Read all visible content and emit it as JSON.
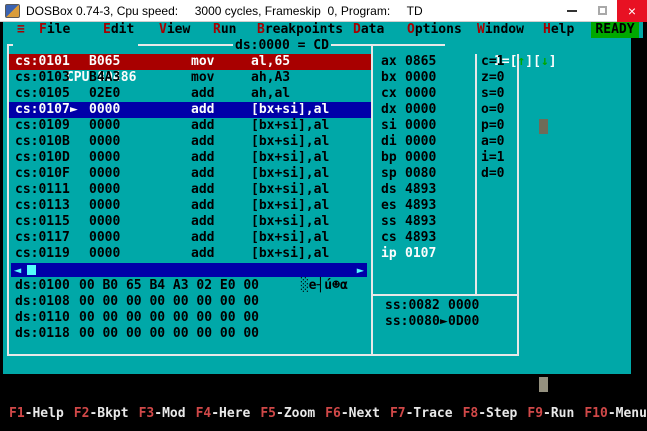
{
  "titlebar": {
    "title": "DOSBox 0.74-3, Cpu speed:     3000 cycles, Frameskip  0, Program:     TD",
    "close_glyph": "×"
  },
  "menubar": {
    "system_glyph": "≡",
    "items": [
      {
        "hot": "F",
        "rest": "ile"
      },
      {
        "hot": "E",
        "rest": "dit"
      },
      {
        "hot": "V",
        "rest": "iew"
      },
      {
        "hot": "R",
        "rest": "un"
      },
      {
        "hot": "B",
        "rest": "reakpoints"
      },
      {
        "hot": "D",
        "rest": "ata"
      },
      {
        "hot": "O",
        "rest": "ptions"
      },
      {
        "hot": "W",
        "rest": "indow"
      },
      {
        "hot": "H",
        "rest": "elp"
      }
    ],
    "status": "READY"
  },
  "cpu_window": {
    "close_pre": "[",
    "close_glyph": "■",
    "close_post": "]",
    "title": "CPU 80486",
    "border_info": "ds:0000 = CD",
    "zoom": {
      "pre": "1=[",
      "up": "↑",
      "mid": "][",
      "down": "↓",
      "post": "]"
    },
    "disasm": [
      {
        "addr": "cs:0101",
        "marker": "",
        "bytes": "B065",
        "mnemonic": "mov",
        "operands": "al,65"
      },
      {
        "addr": "cs:0103",
        "marker": "",
        "bytes": "B4A3",
        "mnemonic": "mov",
        "operands": "ah,A3"
      },
      {
        "addr": "cs:0105",
        "marker": "",
        "bytes": "02E0",
        "mnemonic": "add",
        "operands": "ah,al"
      },
      {
        "addr": "cs:0107",
        "marker": "►",
        "bytes": "0000",
        "mnemonic": "add",
        "operands": "[bx+si],al"
      },
      {
        "addr": "cs:0109",
        "marker": "",
        "bytes": "0000",
        "mnemonic": "add",
        "operands": "[bx+si],al"
      },
      {
        "addr": "cs:010B",
        "marker": "",
        "bytes": "0000",
        "mnemonic": "add",
        "operands": "[bx+si],al"
      },
      {
        "addr": "cs:010D",
        "marker": "",
        "bytes": "0000",
        "mnemonic": "add",
        "operands": "[bx+si],al"
      },
      {
        "addr": "cs:010F",
        "marker": "",
        "bytes": "0000",
        "mnemonic": "add",
        "operands": "[bx+si],al"
      },
      {
        "addr": "cs:0111",
        "marker": "",
        "bytes": "0000",
        "mnemonic": "add",
        "operands": "[bx+si],al"
      },
      {
        "addr": "cs:0113",
        "marker": "",
        "bytes": "0000",
        "mnemonic": "add",
        "operands": "[bx+si],al"
      },
      {
        "addr": "cs:0115",
        "marker": "",
        "bytes": "0000",
        "mnemonic": "add",
        "operands": "[bx+si],al"
      },
      {
        "addr": "cs:0117",
        "marker": "",
        "bytes": "0000",
        "mnemonic": "add",
        "operands": "[bx+si],al"
      },
      {
        "addr": "cs:0119",
        "marker": "",
        "bytes": "0000",
        "mnemonic": "add",
        "operands": "[bx+si],al"
      }
    ],
    "registers": [
      {
        "name": "ax",
        "value": "0865"
      },
      {
        "name": "bx",
        "value": "0000"
      },
      {
        "name": "cx",
        "value": "0000"
      },
      {
        "name": "dx",
        "value": "0000"
      },
      {
        "name": "si",
        "value": "0000"
      },
      {
        "name": "di",
        "value": "0000"
      },
      {
        "name": "bp",
        "value": "0000"
      },
      {
        "name": "sp",
        "value": "0080"
      },
      {
        "name": "ds",
        "value": "4893"
      },
      {
        "name": "es",
        "value": "4893"
      },
      {
        "name": "ss",
        "value": "4893"
      },
      {
        "name": "cs",
        "value": "4893"
      },
      {
        "name": "ip",
        "value": "0107"
      }
    ],
    "flags": [
      {
        "text": "c=1"
      },
      {
        "text": "z=0"
      },
      {
        "text": "s=0"
      },
      {
        "text": "o=0"
      },
      {
        "text": "p=0"
      },
      {
        "text": "a=0"
      },
      {
        "text": "i=1"
      },
      {
        "text": "d=0"
      }
    ],
    "scrollbar": {
      "left_arrow": "◄",
      "right_arrow": "►"
    },
    "dump": [
      {
        "addr": "ds:0100",
        "bytes": "00 B0 65 B4 A3 02 E0 00",
        "ascii": " ░e┤ú☻α"
      },
      {
        "addr": "ds:0108",
        "bytes": "00 00 00 00 00 00 00 00",
        "ascii": ""
      },
      {
        "addr": "ds:0110",
        "bytes": "00 00 00 00 00 00 00 00",
        "ascii": ""
      },
      {
        "addr": "ds:0118",
        "bytes": "00 00 00 00 00 00 00 00",
        "ascii": ""
      }
    ],
    "stack": [
      {
        "addr": "ss:0082",
        "marker": "",
        "value": "0000"
      },
      {
        "addr": "ss:0080",
        "marker": "►",
        "value": "0D00"
      }
    ]
  },
  "fkeys": [
    {
      "key": "F1",
      "label": "-Help"
    },
    {
      "key": "F2",
      "label": "-Bkpt"
    },
    {
      "key": "F3",
      "label": "-Mod"
    },
    {
      "key": "F4",
      "label": "-Here"
    },
    {
      "key": "F5",
      "label": "-Zoom"
    },
    {
      "key": "F6",
      "label": "-Next"
    },
    {
      "key": "F7",
      "label": "-Trace"
    },
    {
      "key": "F8",
      "label": "-Step"
    },
    {
      "key": "F9",
      "label": "-Run"
    },
    {
      "key": "F10",
      "label": "-Menu"
    }
  ],
  "palette": {
    "screen_cyan": "#00A8A8",
    "highlight_blue": "#0000A8",
    "breakpoint_red": "#A80000",
    "status_green": "#00A800",
    "text_black": "#000000",
    "text_white": "#FCFCFC",
    "border_white": "#E8E8E8",
    "scroll_light_cyan": "#54FCFC",
    "fkey_red": "#D04848",
    "close_button_red": "#E81123"
  }
}
